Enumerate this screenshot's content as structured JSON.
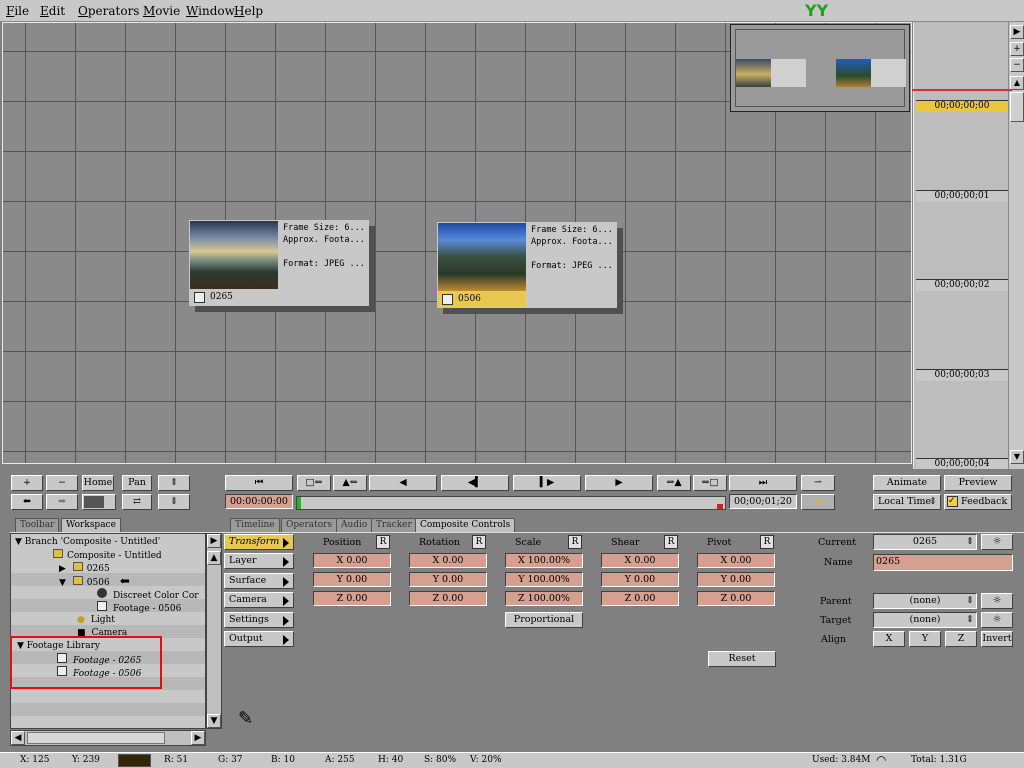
{
  "menu": [
    "File",
    "Edit",
    "Operators",
    "Movie",
    "Window",
    "Help"
  ],
  "logo_text": "YY",
  "nodes": [
    {
      "id": "0265",
      "line1": "Frame Size: 6...",
      "line2": "Approx. Foota...",
      "line3": "Format: JPEG ...",
      "label": "0265"
    },
    {
      "id": "0506",
      "line1": "Frame Size: 6...",
      "line2": "Approx. Foota...",
      "line3": "Format: JPEG ...",
      "label": "0506"
    }
  ],
  "timeline_ticks": [
    "00;00;00;00",
    "00;00;00;01",
    "00;00;00;02",
    "00;00;00;03",
    "00;00;00;04"
  ],
  "scroll_buttons": [
    "▶",
    "+",
    "−"
  ],
  "nav_buttons": {
    "plus": "+",
    "minus": "−",
    "home": "Home",
    "pan": "Pan"
  },
  "transport": {
    "timecode_start": "00:00:00:00",
    "timecode_end": "00;00;01;20",
    "progress_fraction": 0.0
  },
  "right_buttons": {
    "animate": "Animate",
    "preview": "Preview",
    "local_time": "Local Time",
    "feedback": "Feedback"
  },
  "left_tabs": [
    "Toolbar",
    "Workspace"
  ],
  "right_tabs": [
    "Timeline",
    "Operators",
    "Audio",
    "Tracker",
    "Composite Controls"
  ],
  "tree": [
    {
      "text": "Branch 'Composite - Untitled'",
      "indent": 0
    },
    {
      "text": "Composite - Untitled",
      "indent": 1
    },
    {
      "text": "0265",
      "indent": 2
    },
    {
      "text": "0506",
      "indent": 2
    },
    {
      "text": "Discreet Color Cor",
      "indent": 3
    },
    {
      "text": "Footage - 0506",
      "indent": 3
    },
    {
      "text": "Light",
      "indent": 2
    },
    {
      "text": "Camera",
      "indent": 2
    },
    {
      "text": "Footage Library",
      "indent": 0
    },
    {
      "text": "Footage - 0265",
      "indent": 1
    },
    {
      "text": "Footage - 0506",
      "indent": 1
    }
  ],
  "side_buttons": [
    "Transform",
    "Layer",
    "Surface",
    "Camera",
    "Settings",
    "Output"
  ],
  "columns": [
    {
      "title": "Position",
      "x": "X 0.00",
      "y": "Y 0.00",
      "z": "Z 0.00"
    },
    {
      "title": "Rotation",
      "x": "X 0.00",
      "y": "Y 0.00",
      "z": "Z 0.00"
    },
    {
      "title": "Scale",
      "x": "X 100.00%",
      "y": "Y 100.00%",
      "z": "Z 100.00%"
    },
    {
      "title": "Shear",
      "x": "X 0.00",
      "y": "Y 0.00",
      "z": "Z 0.00"
    },
    {
      "title": "Pivot",
      "x": "X 0.00",
      "y": "Y 0.00",
      "z": "Z 0.00"
    }
  ],
  "r_label": "R",
  "proportional": "Proportional",
  "reset": "Reset",
  "props": {
    "current_label": "Current",
    "current_value": "0265",
    "name_label": "Name",
    "name_value": "0265",
    "parent_label": "Parent",
    "parent_value": "(none)",
    "target_label": "Target",
    "target_value": "(none)",
    "align_label": "Align",
    "align_x": "X",
    "align_y": "Y",
    "align_z": "Z",
    "invert": "Invert"
  },
  "status": {
    "x": "X:   125",
    "y": "Y:  239",
    "r": "R: 51",
    "g": "G: 37",
    "b": "B: 10",
    "a": "A: 255",
    "h": "H: 40",
    "s": "S: 80%",
    "v": "V: 20%",
    "used": "Used: 3.84M",
    "total": "Total: 1.31G"
  }
}
